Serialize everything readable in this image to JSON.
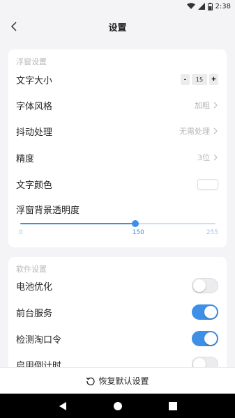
{
  "status_bar": {
    "time": "2:38"
  },
  "header": {
    "title": "设置"
  },
  "float_section": {
    "label": "浮窗设置",
    "font_size": {
      "label": "文字大小",
      "minus": "-",
      "value": "15",
      "plus": "+"
    },
    "font_style": {
      "label": "字体风格",
      "value": "加粗"
    },
    "jitter": {
      "label": "抖动处理",
      "value": "无需处理"
    },
    "precision": {
      "label": "精度",
      "value": "3位"
    },
    "text_color": {
      "label": "文字颜色",
      "color": "#ffffff"
    },
    "bg_opacity": {
      "label": "浮窗背景透明度",
      "min": "0",
      "current": "150",
      "max": "255",
      "value_fraction": 0.588,
      "accent": "#3d8fe8"
    }
  },
  "software_section": {
    "label": "软件设置",
    "items": [
      {
        "label": "电池优化",
        "on": false
      },
      {
        "label": "前台服务",
        "on": true
      },
      {
        "label": "检测淘口令",
        "on": true
      },
      {
        "label": "启用倒计时",
        "on": false
      }
    ]
  },
  "footer": {
    "reset_label": "恢复默认设置"
  }
}
